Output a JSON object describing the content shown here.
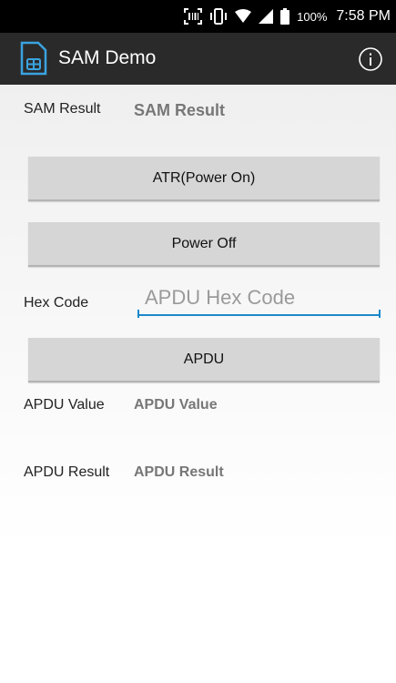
{
  "status_bar": {
    "battery_percent": "100%",
    "time": "7:58 PM"
  },
  "app_bar": {
    "title": "SAM Demo",
    "icons": {
      "app": "sim-card-icon",
      "info": "info-icon"
    }
  },
  "sam_result": {
    "label": "SAM Result",
    "value": "SAM Result"
  },
  "buttons": {
    "atr": "ATR(Power On)",
    "power_off": "Power Off",
    "apdu": "APDU"
  },
  "hex_code": {
    "label": "Hex Code",
    "placeholder": "APDU Hex Code",
    "value": ""
  },
  "apdu_value": {
    "label": "APDU Value",
    "value": "APDU Value"
  },
  "apdu_result": {
    "label": "APDU Result",
    "value": "APDU Result"
  },
  "colors": {
    "appbar": "#2a2a2a",
    "statusbar": "#000000",
    "accent": "#1a88c9",
    "button": "#d6d6d6"
  }
}
